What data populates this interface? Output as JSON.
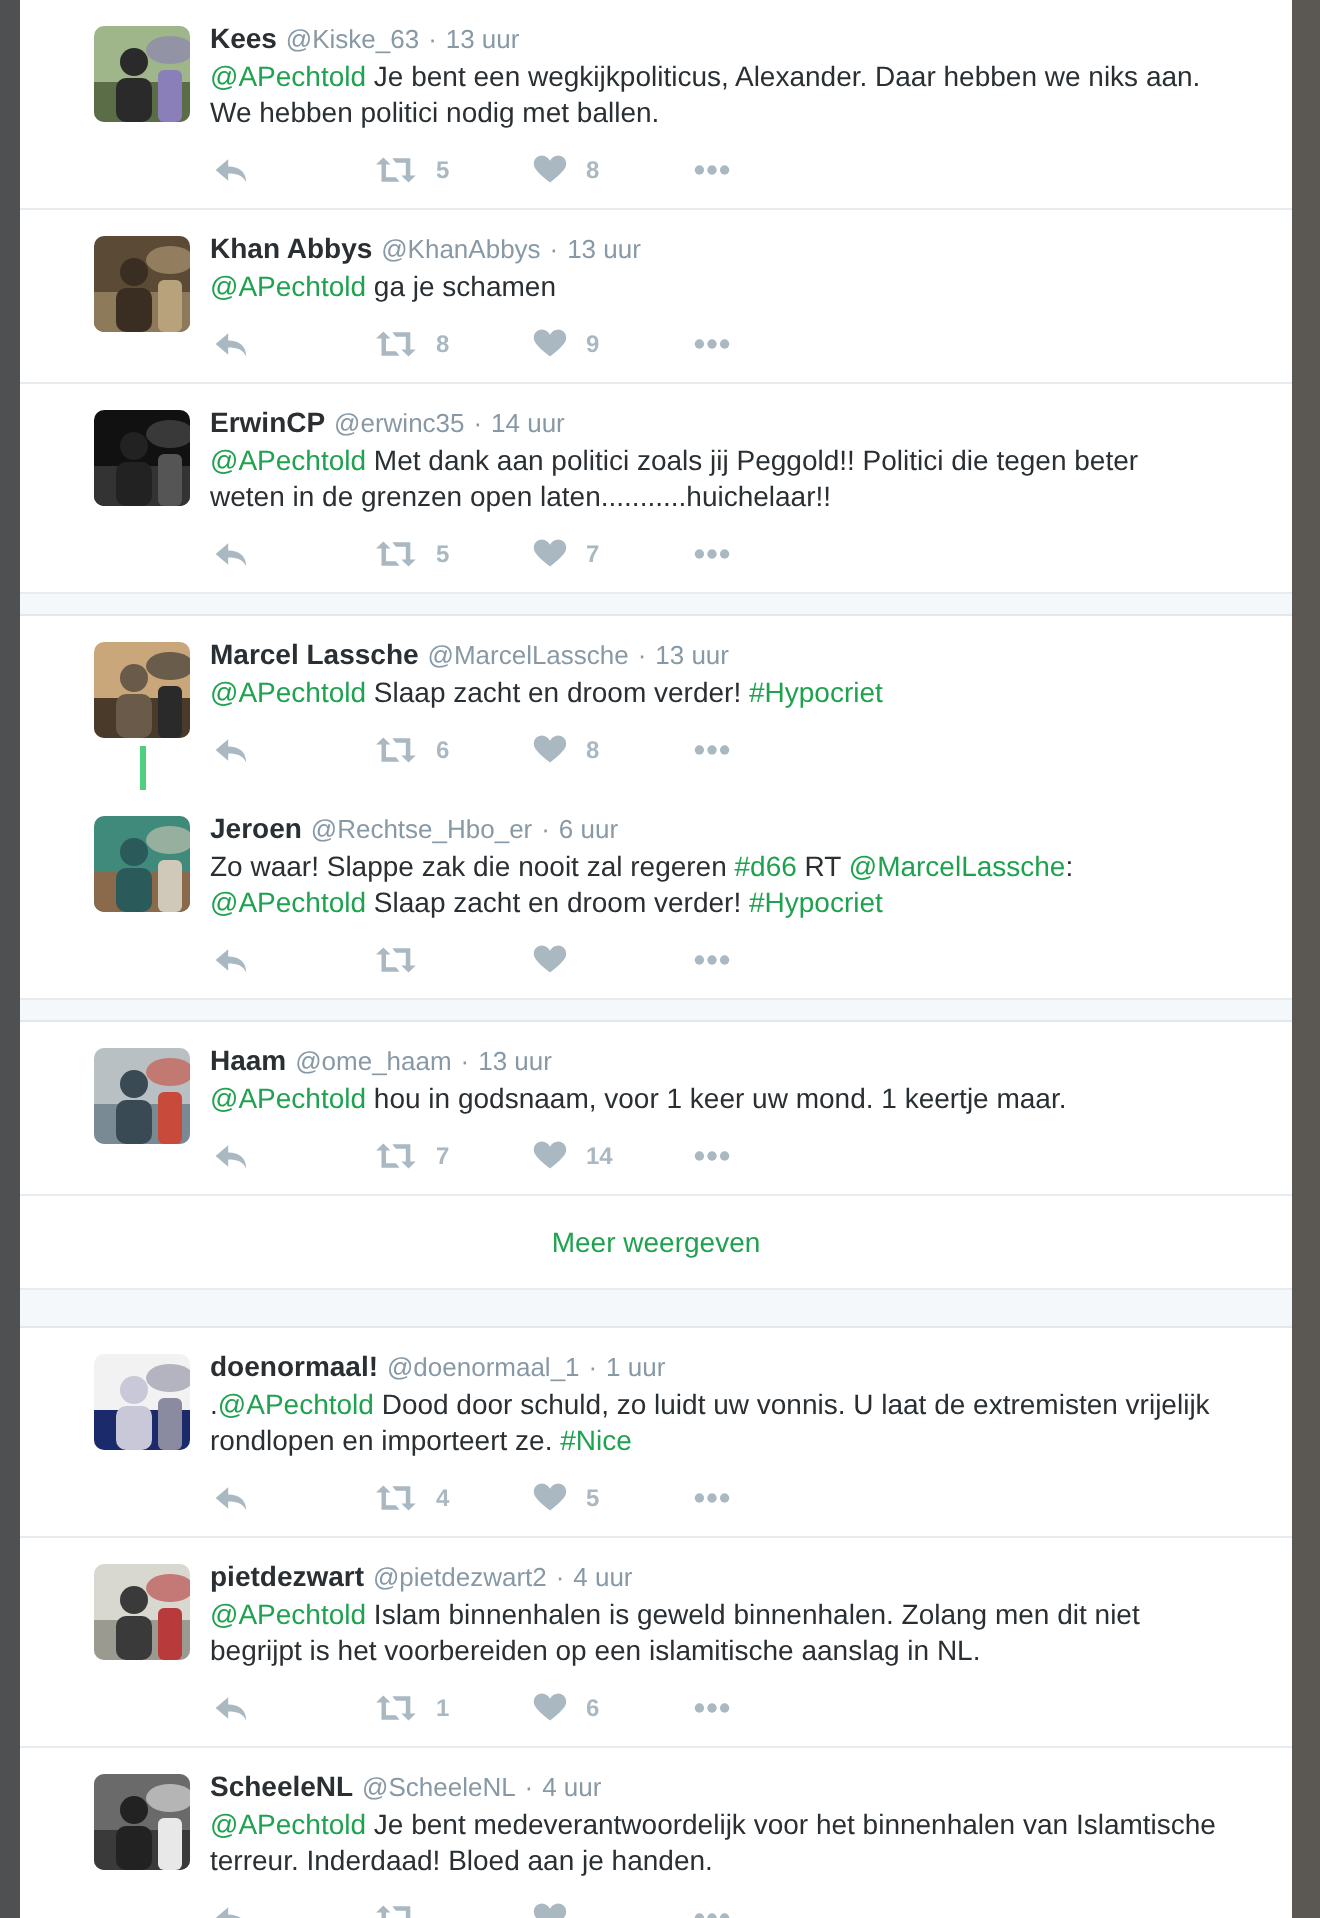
{
  "groups": [
    {
      "tweets": [
        {
          "name": "Kees",
          "handle": "@Kiske_63",
          "separator": "·",
          "time": "13 uur",
          "connected_to_next": false,
          "text": [
            {
              "kind": "mention",
              "text": "@APechtold"
            },
            {
              "kind": "text",
              "text": " Je bent een wegkijkpoliticus, Alexander. Daar hebben we niks aan. We hebben politici nodig met ballen."
            }
          ],
          "retweets": "5",
          "likes": "8"
        },
        {
          "name": "Khan Abbys",
          "handle": "@KhanAbbys",
          "separator": "·",
          "time": "13 uur",
          "connected_to_next": false,
          "text": [
            {
              "kind": "mention",
              "text": "@APechtold"
            },
            {
              "kind": "text",
              "text": " ga je schamen"
            }
          ],
          "retweets": "8",
          "likes": "9"
        },
        {
          "name": "ErwinCP",
          "handle": "@erwinc35",
          "separator": "·",
          "time": "14 uur",
          "connected_to_next": false,
          "text": [
            {
              "kind": "mention",
              "text": "@APechtold"
            },
            {
              "kind": "text",
              "text": " Met dank aan politici zoals jij Peggold!! Politici die tegen beter weten in de grenzen open laten...........huichelaar!!"
            }
          ],
          "retweets": "5",
          "likes": "7"
        }
      ]
    },
    {
      "tweets": [
        {
          "name": "Marcel Lassche",
          "handle": "@MarcelLassche",
          "separator": "·",
          "time": "13 uur",
          "connected_to_next": true,
          "text": [
            {
              "kind": "mention",
              "text": "@APechtold"
            },
            {
              "kind": "text",
              "text": " Slaap zacht en droom verder! "
            },
            {
              "kind": "hashtag",
              "text": "#Hypocriet"
            }
          ],
          "retweets": "6",
          "likes": "8"
        },
        {
          "name": "Jeroen",
          "handle": "@Rechtse_Hbo_er",
          "separator": "·",
          "time": "6 uur",
          "connected_to_next": false,
          "text": [
            {
              "kind": "text",
              "text": "Zo waar! Slappe zak die nooit zal regeren "
            },
            {
              "kind": "hashtag",
              "text": "#d66"
            },
            {
              "kind": "text",
              "text": " RT "
            },
            {
              "kind": "mention",
              "text": "@MarcelLassche"
            },
            {
              "kind": "text",
              "text": ": "
            },
            {
              "kind": "mention",
              "text": "@APechtold"
            },
            {
              "kind": "text",
              "text": " Slaap zacht en droom verder! "
            },
            {
              "kind": "hashtag",
              "text": "#Hypocriet"
            }
          ]
        }
      ]
    },
    {
      "tweets": [
        {
          "name": "Haam",
          "handle": "@ome_haam",
          "separator": "·",
          "time": "13 uur",
          "connected_to_next": false,
          "text": [
            {
              "kind": "mention",
              "text": "@APechtold"
            },
            {
              "kind": "text",
              "text": " hou in godsnaam, voor 1 keer uw mond. 1 keertje maar."
            }
          ],
          "retweets": "7",
          "likes": "14"
        }
      ],
      "show_more": "Meer weergeven"
    },
    {
      "tweets": [
        {
          "name": "doenormaal!",
          "handle": "@doenormaal_1",
          "separator": "·",
          "time": "1 uur",
          "connected_to_next": false,
          "text": [
            {
              "kind": "text",
              "text": "."
            },
            {
              "kind": "mention",
              "text": "@APechtold"
            },
            {
              "kind": "text",
              "text": " Dood door schuld, zo luidt uw vonnis. U laat de extremisten vrijelijk rondlopen en importeert ze. "
            },
            {
              "kind": "hashtag",
              "text": "#Nice"
            }
          ],
          "retweets": "4",
          "likes": "5"
        },
        {
          "name": "pietdezwart",
          "handle": "@pietdezwart2",
          "separator": "·",
          "time": "4 uur",
          "connected_to_next": false,
          "text": [
            {
              "kind": "mention",
              "text": "@APechtold"
            },
            {
              "kind": "text",
              "text": " Islam binnenhalen is geweld binnenhalen. Zolang men dit niet begrijpt is het voorbereiden op een islamitische aanslag in NL."
            }
          ],
          "retweets": "1",
          "likes": "6"
        },
        {
          "name": "ScheeleNL",
          "handle": "@ScheeleNL",
          "separator": "·",
          "time": "4 uur",
          "connected_to_next": false,
          "text": [
            {
              "kind": "mention",
              "text": "@APechtold"
            },
            {
              "kind": "text",
              "text": " Je bent medeverantwoordelijk voor het binnenhalen van Islamtische terreur. Inderdaad! Bloed aan je handen."
            }
          ]
        }
      ]
    }
  ]
}
